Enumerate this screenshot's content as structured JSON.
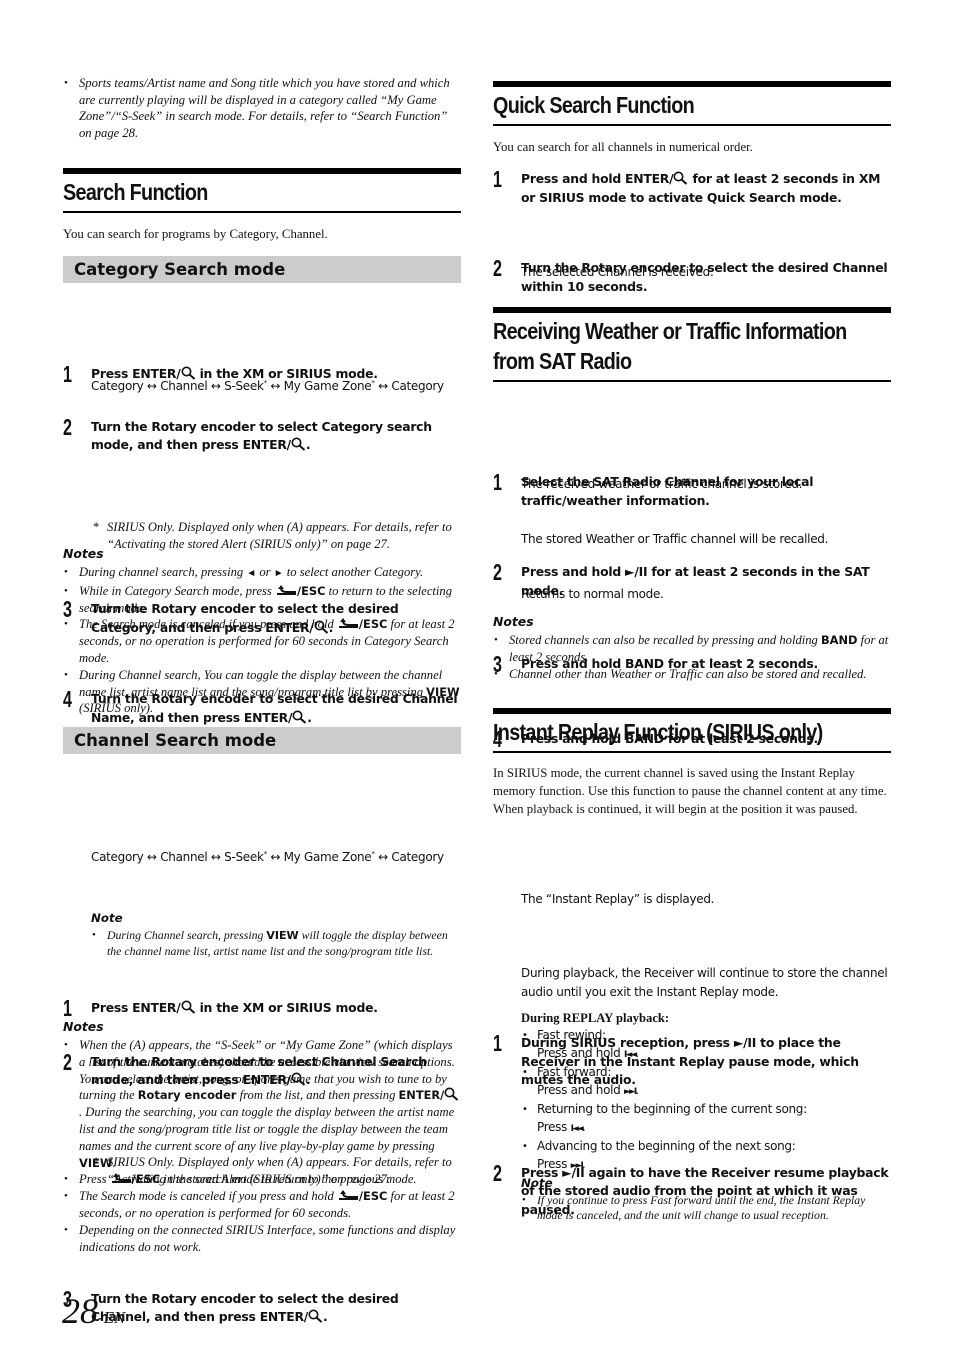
{
  "intro_note": "Sports teams/Artist name and Song title which you have stored and which are currently playing will be displayed in a category called “My Game Zone”/“S-Seek” in search mode. For details, refer to “Search Function” on page 28.",
  "search_function": {
    "title": "Search Function",
    "lead": "You can search for programs by Category, Channel.",
    "category_mode": {
      "title": "Category Search mode",
      "step1": {
        "num": "1",
        "a": "Press ",
        "b": "ENTER/",
        "c": " in the XM or SIRIUS mode."
      },
      "step2": {
        "num": "2",
        "a": "Turn the ",
        "b": "Rotary encoder",
        "c": " to select Category search mode, and then press ",
        "d": "ENTER/",
        "e": "."
      },
      "cycle": "Category ↔ Channel ↔ S-Seek* ↔ My Game Zone* ↔ Category",
      "cycle_parts": [
        "Category ↔ Channel ↔ S-Seek",
        "*",
        " ↔ My Game Zone",
        "*",
        " ↔ Category"
      ],
      "star_note": "SIRIUS Only. Displayed only when (A) appears. For details, refer to “Activating the stored Alert (SIRIUS only)” on page 27.",
      "step3": {
        "num": "3",
        "a": "Turn the ",
        "b": "Rotary encoder",
        "c": " to select the desired Category, and then press ",
        "d": "ENTER/",
        "e": "."
      },
      "step4": {
        "num": "4",
        "a": "Turn the ",
        "b": "Rotary encoder",
        "c": " to select the desired Channel Name, and then press ",
        "d": "ENTER/",
        "e": "."
      },
      "notes_title": "Notes",
      "notes": [
        {
          "a": "During channel search, pressing ",
          "b": "◄",
          "c": " or ",
          "d": "►",
          "e": " to select another Category."
        },
        {
          "a": "While in Category Search mode, press ",
          "esc": "/ESC",
          "c": " to return to the selecting search mode."
        },
        {
          "a": "The Search mode is canceled if you press and hold ",
          "esc": "/ESC",
          "c": " for at least 2 seconds, or no operation is performed for 60 seconds in Category Search mode."
        },
        {
          "a": "During Channel search, You can toggle the display between the channel name list, artist name list and the song/program title list by pressing ",
          "b": "VIEW",
          "c": " (SIRIUS only)."
        }
      ]
    },
    "channel_mode": {
      "title": "Channel Search mode",
      "step1": {
        "num": "1",
        "a": "Press ",
        "b": "ENTER/",
        "c": " in the XM or SIRIUS mode."
      },
      "step2": {
        "num": "2",
        "a": "Turn the ",
        "b": "Rotary encoder",
        "c": " to select Channel Search mode, and then press ",
        "d": "ENTER/",
        "e": "."
      },
      "cycle_parts": [
        "Category ↔ Channel ↔ S-Seek",
        "*",
        " ↔ My Game Zone",
        "*",
        " ↔ Category"
      ],
      "star_note": "SIRIUS Only. Displayed only when (A) appears. For details, refer to “Activating the stored Alert (SIRIUS only)” on page 27.",
      "note_title": "Note",
      "note": {
        "a": "During Channel search, pressing ",
        "b": "VIEW",
        "c": " will toggle the display between the channel name list, artist name list and the song/program title list."
      },
      "step3": {
        "num": "3",
        "a": "Turn the ",
        "b": "Rotary encoder",
        "c": " to select the desired Channel, and then press ",
        "d": "ENTER/",
        "e": "."
      },
      "notes_title": "Notes",
      "notes": [
        {
          "a": "When the (A) appears, the “S-Seek” or “My Game Zone” (which displays a list of the current matches) should be accessible via view search options. You can select the artist, song, or sports game that you wish to tune to by turning the ",
          "b": "Rotary encoder",
          "c": " from the list, and then pressing ",
          "d": "ENTER/",
          "e": ". During the searching, you can toggle the display between the artist name list and the song/program title list or toggle the display between the team names and the current score of any live play-by-play game by pressing ",
          "f": "VIEW",
          "g": "."
        },
        {
          "a": "Press ",
          "esc": "/ESC",
          "c": " in the search mode to return to the previous mode."
        },
        {
          "a": "The Search mode is canceled if you press and hold ",
          "esc": "/ESC",
          "c": " for at least 2 seconds, or no operation is performed for 60 seconds."
        },
        {
          "a": "Depending on the connected SIRIUS Interface, some functions and display indications do not work."
        }
      ]
    }
  },
  "quick_search": {
    "title": "Quick Search Function",
    "lead": "You can search for all channels in numerical order.",
    "step1": {
      "num": "1",
      "a": "Press and hold ",
      "b": "ENTER/",
      "c": " for at least 2 seconds in XM or SIRIUS mode to activate Quick Search mode."
    },
    "step2": {
      "num": "2",
      "a": "Turn the ",
      "b": "Rotary encoder",
      "c": " to select the desired Channel within 10 seconds."
    },
    "step2_result": "The selected Channel is received."
  },
  "weather_traffic": {
    "title_line1": "Receiving Weather or Traffic Information",
    "title_line2": "from SAT Radio",
    "step1": {
      "num": "1",
      "a": "Select the SAT Radio Channel for your local traffic/weather information."
    },
    "step2": {
      "num": "2",
      "a": "Press and hold ",
      "b": "►/II",
      "c": " for at least 2 seconds in the SAT mode."
    },
    "step2_result": "The received weather or traffic channel is stored.",
    "step3": {
      "num": "3",
      "a": "Press and hold ",
      "b": "BAND",
      "c": " for at least 2 seconds."
    },
    "step3_result": "The stored Weather or Traffic channel will be recalled.",
    "step4": {
      "num": "4",
      "a": "Press and hold ",
      "b": "BAND",
      "c": " for at least 2 seconds."
    },
    "step4_result": "Returns to normal mode.",
    "notes_title": "Notes",
    "notes": [
      {
        "a": "Stored channels can also be recalled by pressing and holding ",
        "b": "BAND",
        "c": " for at least 2 seconds."
      },
      {
        "a": "Channel other than Weather or Traffic can also be stored and recalled."
      }
    ]
  },
  "instant_replay": {
    "title": "Instant Replay Function (SIRIUS only)",
    "lead": "In SIRIUS mode, the current channel is saved using the Instant Replay memory function. Use this function to pause the channel content at any time. When playback is continued, it will begin at the position it was paused.",
    "step1": {
      "num": "1",
      "a": "During SIRIUS reception, press ",
      "b": "►/II",
      "c": " to place the Receiver in the Instant Replay pause mode, which mutes the audio."
    },
    "step1_result": "The “Instant Replay” is displayed.",
    "step2": {
      "num": "2",
      "a": "Press ",
      "b": "►/II",
      "c": " again to have the Receiver resume playback of the stored audio from the point at which it was paused."
    },
    "step2_result": "During playback, the Receiver will continue to store the channel audio until you exit the Instant Replay mode.",
    "replay_title": "During REPLAY playback:",
    "replay_items": [
      {
        "label": "Fast rewind:",
        "action": "Press and hold ",
        "sym": "I◄◄",
        "end": "."
      },
      {
        "label": "Fast forward:",
        "action": "Press and hold ",
        "sym": "►►I",
        "end": "."
      },
      {
        "label": "Returning to the beginning of the current song:",
        "action": "Press ",
        "sym": "I◄◄",
        "end": "."
      },
      {
        "label": "Advancing to the beginning of the next song:",
        "action": "Press ",
        "sym": "►►I",
        "end": "."
      }
    ],
    "note_title": "Note",
    "note": "If you continue to press Fast forward until the end, the Instant Replay mode is canceled, and the unit will change to usual reception."
  },
  "page": {
    "number": "28",
    "suffix": "-EN"
  },
  "icons": {
    "search": "search-icon",
    "return": "return-arrow-icon",
    "play_pause": "play-pause-icon",
    "rewind": "skip-back-icon",
    "forward": "skip-forward-icon"
  }
}
